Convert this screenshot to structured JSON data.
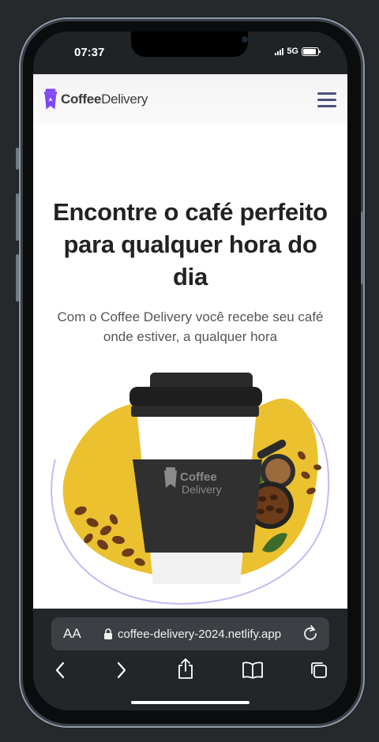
{
  "status_bar": {
    "time": "07:37",
    "network": "5G"
  },
  "site": {
    "logo_bold": "Coffee",
    "logo_regular": "Delivery",
    "menu_icon": "hamburger-menu-icon",
    "brand_color": "#8047F8",
    "accent_yellow": "#EBC12F"
  },
  "hero": {
    "title": "Encontre o café perfeito para qualquer hora do dia",
    "subtitle": "Com o Coffee Delivery você recebe seu café onde estiver, a qualquer hora",
    "cup_logo_bold": "Coffee",
    "cup_logo_regular": "Delivery"
  },
  "browser": {
    "text_size_label": "AA",
    "url": "coffee-delivery-2024.netlify.app",
    "icons": [
      "back-icon",
      "forward-icon",
      "share-icon",
      "bookmarks-icon",
      "tabs-icon",
      "reload-icon",
      "lock-icon"
    ]
  }
}
